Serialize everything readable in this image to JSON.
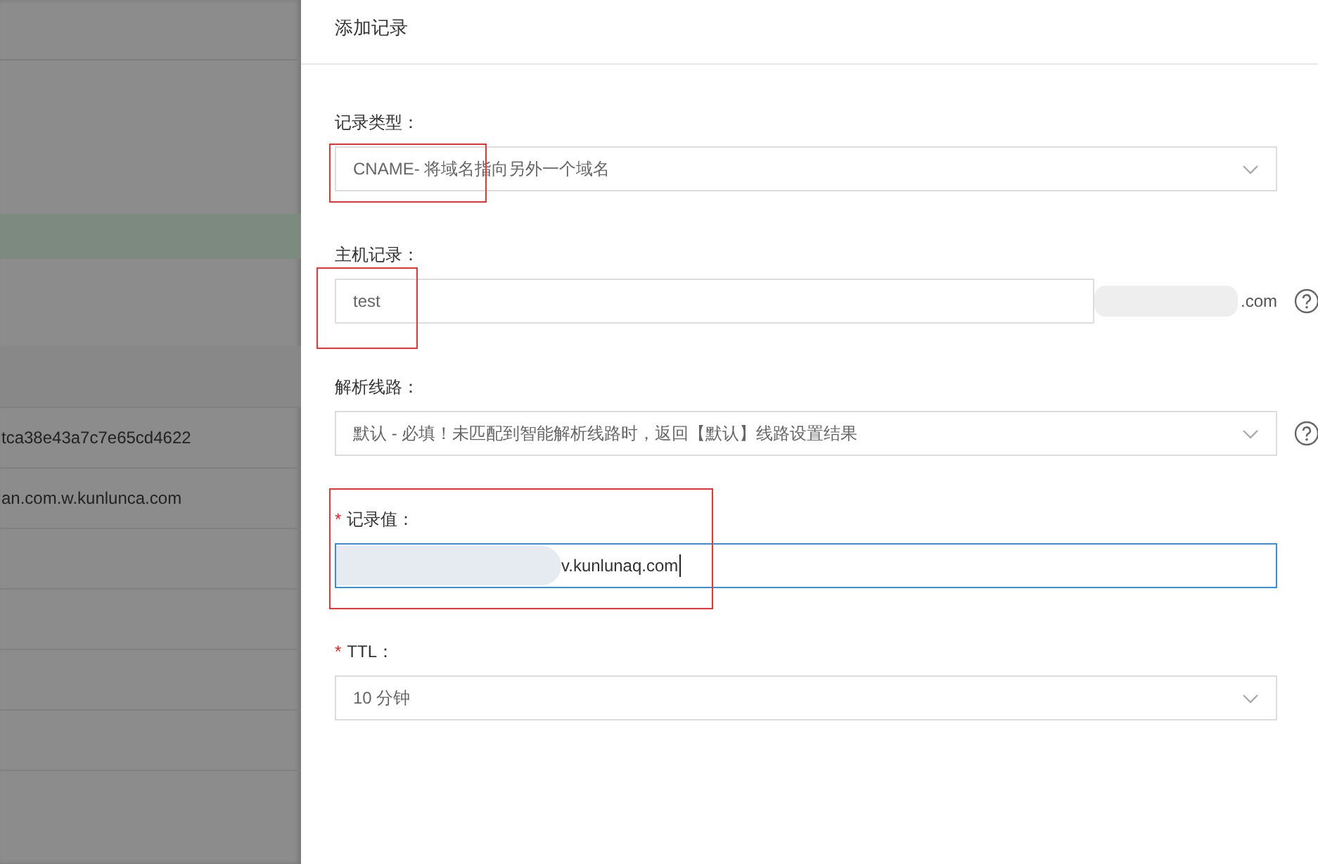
{
  "background_table": {
    "rows": [
      "tca38e43a7c7e65cd4622",
      "an.com.w.kunlunca.com"
    ]
  },
  "dialog": {
    "title": "添加记录",
    "fields": [
      {
        "kind": "select",
        "label": "记录类型：",
        "value": "CNAME- 将域名指向另外一个域名",
        "highlighted": true
      },
      {
        "kind": "input",
        "label": "主机记录：",
        "value": "test",
        "highlighted": true,
        "help": true,
        "suffix": ".com",
        "suffix_blurred": true
      },
      {
        "kind": "select",
        "label": "解析线路：",
        "value": "默认 - 必填！未匹配到智能解析线路时，返回【默认】线路设置结果",
        "help": true
      },
      {
        "kind": "input",
        "required_mark": "*",
        "label": "记录值：",
        "value": "v.kunlunaq.com",
        "highlighted": true,
        "focused": true,
        "value_blurred": true
      },
      {
        "kind": "select",
        "required_mark": "*",
        "label": "TTL：",
        "value": "10 分钟"
      }
    ]
  }
}
